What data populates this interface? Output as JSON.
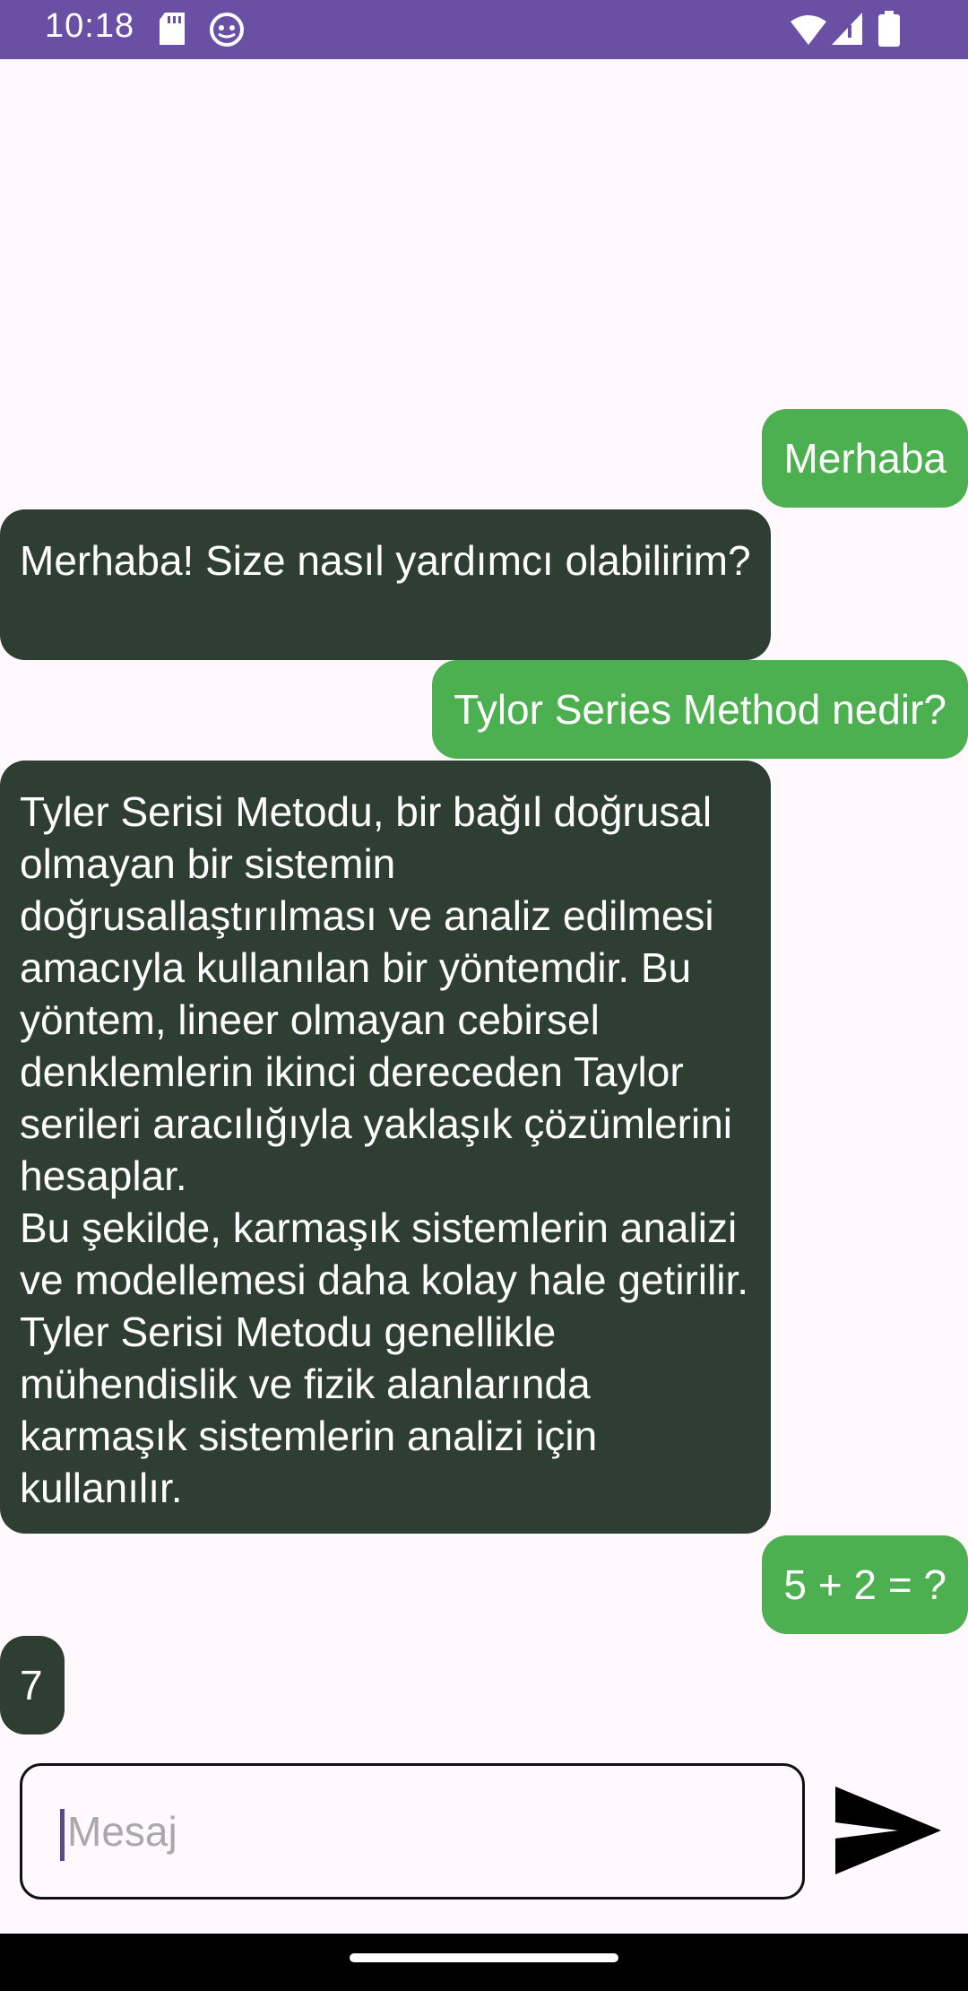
{
  "status_bar": {
    "time": "10:18",
    "icons": [
      "sd-card-icon",
      "android-debug-icon",
      "wifi-icon",
      "signal-icon",
      "battery-icon"
    ]
  },
  "messages": [
    {
      "role": "user",
      "text": "Merhaba"
    },
    {
      "role": "bot",
      "text": "Merhaba! Size nasıl yardımcı olabilirim?"
    },
    {
      "role": "user",
      "text": "Tylor Series Method  nedir?"
    },
    {
      "role": "bot",
      "text": "Tyler Serisi Metodu, bir bağıl doğrusal olmayan bir sistemin doğrusallaştırılması ve analiz edilmesi amacıyla kullanılan bir yöntemdir. Bu yöntem, lineer olmayan cebirsel denklemlerin ikinci dereceden Taylor serileri aracılığıyla yaklaşık çözümlerini hesaplar.\nBu şekilde, karmaşık sistemlerin analizi ve modellemesi daha kolay hale getirilir. Tyler Serisi Metodu genellikle mühendislik ve fizik alanlarında karmaşık sistemlerin analizi için kullanılır."
    },
    {
      "role": "user",
      "text": "5 + 2 = ?"
    },
    {
      "role": "bot",
      "text": "7"
    }
  ],
  "composer": {
    "placeholder": "Mesaj",
    "send_icon": "send-icon"
  },
  "colors": {
    "status_bar": "#6A50A4",
    "user_bubble": "#4CAF50",
    "bot_bubble": "#2F3E32",
    "background": "#FFF8FC"
  }
}
